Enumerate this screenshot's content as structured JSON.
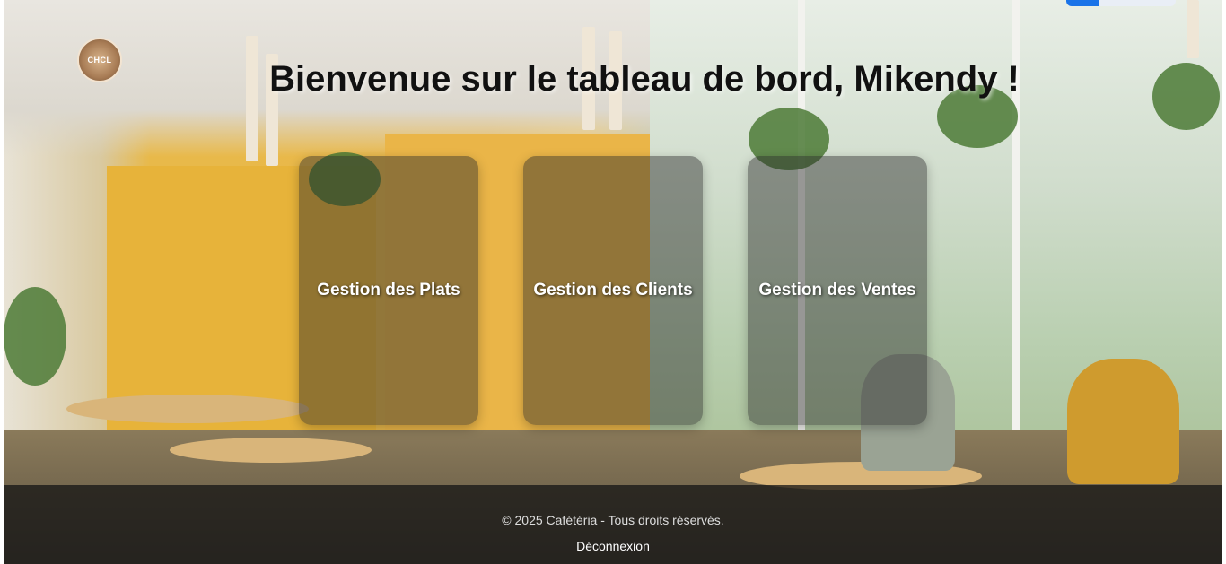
{
  "header": {
    "title": "Bienvenue sur le tableau de bord, Mikendy !",
    "logo_text": "CHCL"
  },
  "cards": [
    {
      "label": "Gestion des Plats"
    },
    {
      "label": "Gestion des Clients"
    },
    {
      "label": "Gestion des Ventes"
    }
  ],
  "footer": {
    "copyright": "© 2025 Cafétéria - Tous droits réservés.",
    "logout_label": "Déconnexion"
  },
  "colors": {
    "card_overlay": "#282828",
    "footer_bg": "#141414"
  }
}
